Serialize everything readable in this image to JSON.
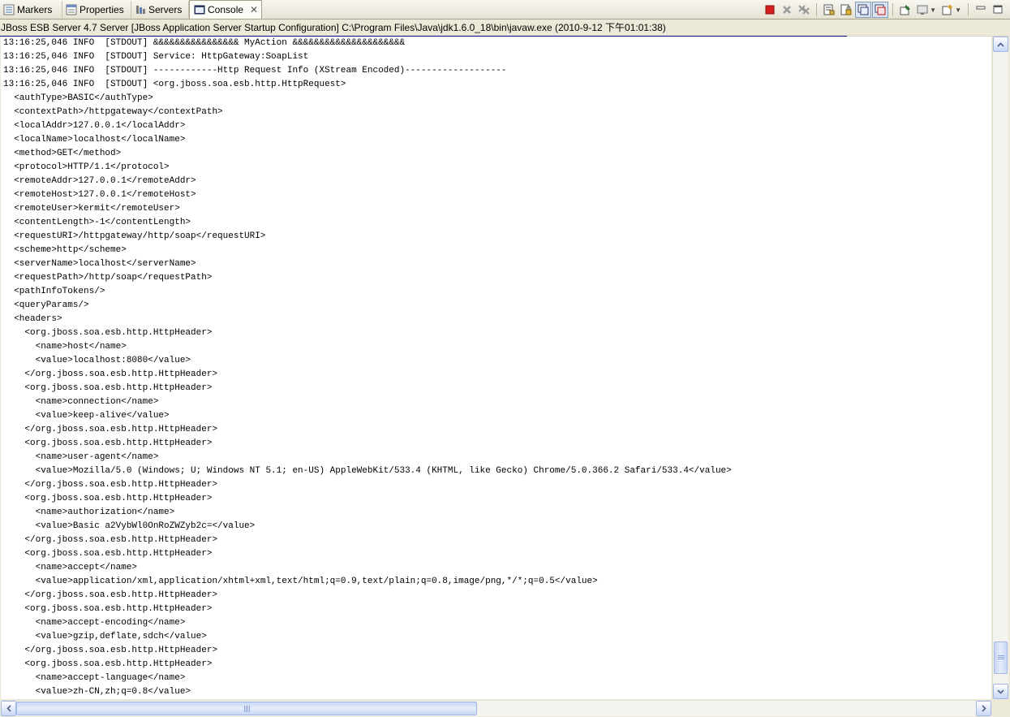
{
  "tabs": [
    {
      "label": "Markers",
      "icon": "markers-icon"
    },
    {
      "label": "Properties",
      "icon": "properties-icon"
    },
    {
      "label": "Servers",
      "icon": "servers-icon"
    },
    {
      "label": "Console",
      "icon": "console-icon",
      "active": true,
      "close": "✕"
    }
  ],
  "process_title": "JBoss ESB Server 4.7 Server [JBoss Application Server Startup Configuration] C:\\Program Files\\Java\\jdk1.6.0_18\\bin\\javaw.exe (2010-9-12 下午01:01:38)",
  "console_lines": [
    "13:16:25,046 INFO  [STDOUT] &&&&&&&&&&&&&&&& MyAction &&&&&&&&&&&&&&&&&&&&&",
    "13:16:25,046 INFO  [STDOUT] Service: HttpGateway:SoapList",
    "13:16:25,046 INFO  [STDOUT] ------------Http Request Info (XStream Encoded)-------------------",
    "13:16:25,046 INFO  [STDOUT] <org.jboss.soa.esb.http.HttpRequest>",
    "  <authType>BASIC</authType>",
    "  <contextPath>/httpgateway</contextPath>",
    "  <localAddr>127.0.0.1</localAddr>",
    "  <localName>localhost</localName>",
    "  <method>GET</method>",
    "  <protocol>HTTP/1.1</protocol>",
    "  <remoteAddr>127.0.0.1</remoteAddr>",
    "  <remoteHost>127.0.0.1</remoteHost>",
    "  <remoteUser>kermit</remoteUser>",
    "  <contentLength>-1</contentLength>",
    "  <requestURI>/httpgateway/http/soap</requestURI>",
    "  <scheme>http</scheme>",
    "  <serverName>localhost</serverName>",
    "  <requestPath>/http/soap</requestPath>",
    "  <pathInfoTokens/>",
    "  <queryParams/>",
    "  <headers>",
    "    <org.jboss.soa.esb.http.HttpHeader>",
    "      <name>host</name>",
    "      <value>localhost:8080</value>",
    "    </org.jboss.soa.esb.http.HttpHeader>",
    "    <org.jboss.soa.esb.http.HttpHeader>",
    "      <name>connection</name>",
    "      <value>keep-alive</value>",
    "    </org.jboss.soa.esb.http.HttpHeader>",
    "    <org.jboss.soa.esb.http.HttpHeader>",
    "      <name>user-agent</name>",
    "      <value>Mozilla/5.0 (Windows; U; Windows NT 5.1; en-US) AppleWebKit/533.4 (KHTML, like Gecko) Chrome/5.0.366.2 Safari/533.4</value>",
    "    </org.jboss.soa.esb.http.HttpHeader>",
    "    <org.jboss.soa.esb.http.HttpHeader>",
    "      <name>authorization</name>",
    "      <value>Basic a2VybWl0OnRoZWZyb2c=</value>",
    "    </org.jboss.soa.esb.http.HttpHeader>",
    "    <org.jboss.soa.esb.http.HttpHeader>",
    "      <name>accept</name>",
    "      <value>application/xml,application/xhtml+xml,text/html;q=0.9,text/plain;q=0.8,image/png,*/*;q=0.5</value>",
    "    </org.jboss.soa.esb.http.HttpHeader>",
    "    <org.jboss.soa.esb.http.HttpHeader>",
    "      <name>accept-encoding</name>",
    "      <value>gzip,deflate,sdch</value>",
    "    </org.jboss.soa.esb.http.HttpHeader>",
    "    <org.jboss.soa.esb.http.HttpHeader>",
    "      <name>accept-language</name>",
    "      <value>zh-CN,zh;q=0.8</value>"
  ],
  "colors": {
    "terminate_red": "#d81e1e",
    "scroll_blue": "#c9d7f5",
    "title_underline": "#000080"
  },
  "toolbar_icons": [
    "terminate-icon",
    "remove-launch-icon",
    "remove-all-terminated-icon",
    "clear-console-icon",
    "scroll-lock-icon",
    "show-on-stdout-icon",
    "show-on-stderr-icon",
    "pin-console-icon",
    "display-selected-console-icon",
    "open-console-icon",
    "minimize-icon",
    "maximize-icon"
  ]
}
